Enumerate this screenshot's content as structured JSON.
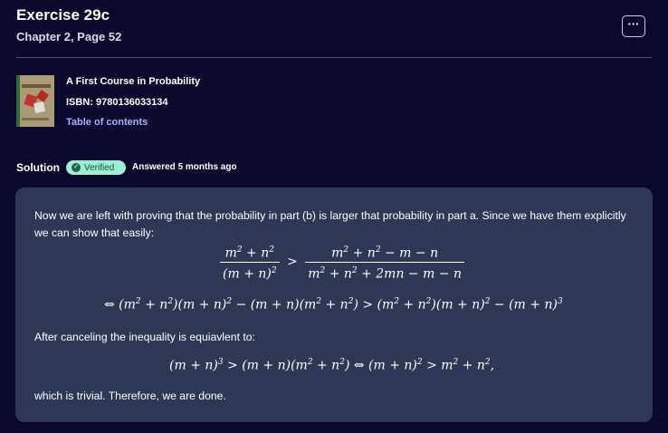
{
  "header": {
    "title": "Exercise 29c",
    "subtitle": "Chapter 2, Page 52",
    "more_label": "···"
  },
  "book": {
    "title": "A First Course in Probability",
    "isbn": "ISBN: 9780136033134",
    "toc_label": "Table of contents",
    "cover_icon": "book-cover-image"
  },
  "solution": {
    "label": "Solution",
    "verified_label": "Verified",
    "answered": "Answered 5 months ago",
    "paragraph1": "Now we are left with proving that the probability in part (b) is larger that probability in part a. Since we have them explicitly we can show that easily:",
    "paragraph2": "After canceling the inequality is equiavlent to:",
    "paragraph3": "which is trivial. Therefore, we are done."
  },
  "colors": {
    "background": "#0a092d",
    "card": "#2e3856",
    "link": "#a8b1ff",
    "badge": "#98f1d1"
  }
}
